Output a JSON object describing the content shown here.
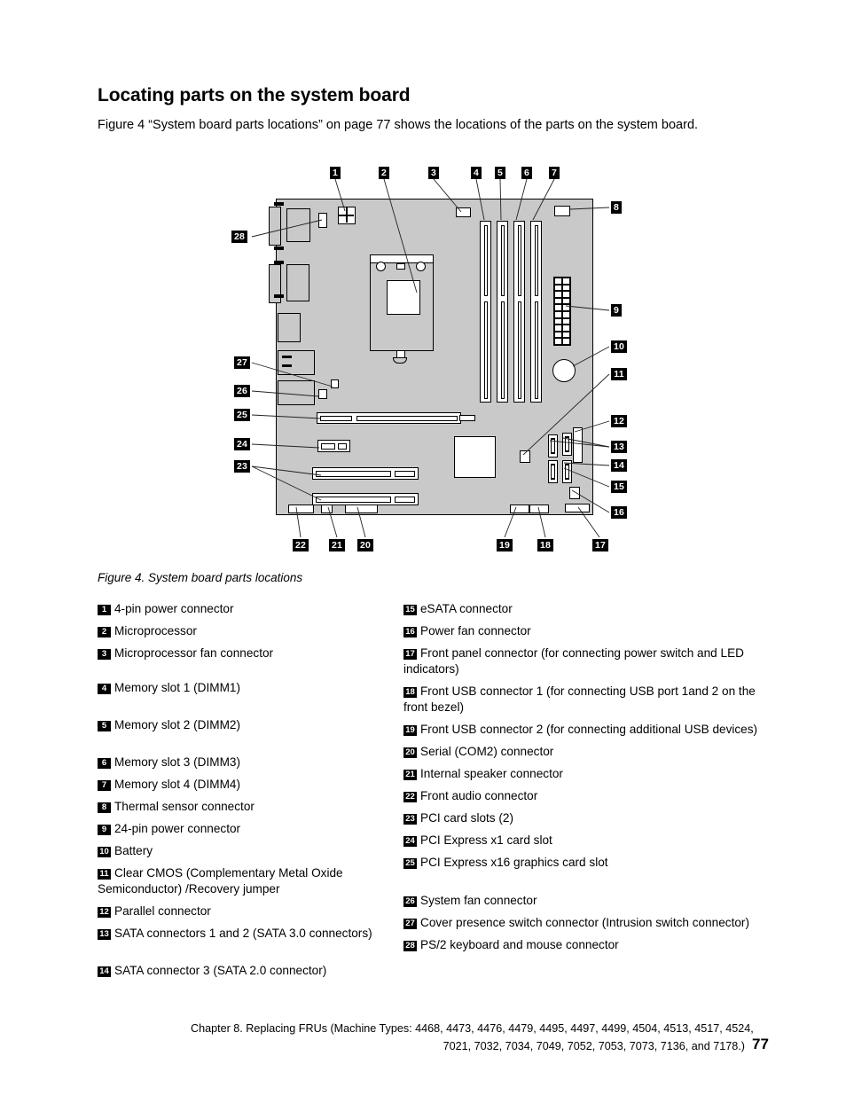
{
  "document": {
    "title": "Locating parts on the system board",
    "intro": "Figure 4 “System board parts locations” on page 77 shows the locations of the parts on the system board.",
    "figure_caption": "Figure 4.  System board parts locations"
  },
  "figure": {
    "callouts": [
      {
        "id": "1",
        "label": "1"
      },
      {
        "id": "2",
        "label": "2"
      },
      {
        "id": "3",
        "label": "3"
      },
      {
        "id": "4",
        "label": "4"
      },
      {
        "id": "5",
        "label": "5"
      },
      {
        "id": "6",
        "label": "6"
      },
      {
        "id": "7",
        "label": "7"
      },
      {
        "id": "8",
        "label": "8"
      },
      {
        "id": "9",
        "label": "9"
      },
      {
        "id": "10",
        "label": "10"
      },
      {
        "id": "11",
        "label": "11"
      },
      {
        "id": "12",
        "label": "12"
      },
      {
        "id": "13",
        "label": "13"
      },
      {
        "id": "14",
        "label": "14"
      },
      {
        "id": "15",
        "label": "15"
      },
      {
        "id": "16",
        "label": "16"
      },
      {
        "id": "17",
        "label": "17"
      },
      {
        "id": "18",
        "label": "18"
      },
      {
        "id": "19",
        "label": "19"
      },
      {
        "id": "20",
        "label": "20"
      },
      {
        "id": "21",
        "label": "21"
      },
      {
        "id": "22",
        "label": "22"
      },
      {
        "id": "23",
        "label": "23"
      },
      {
        "id": "24",
        "label": "24"
      },
      {
        "id": "25",
        "label": "25"
      },
      {
        "id": "26",
        "label": "26"
      },
      {
        "id": "27",
        "label": "27"
      },
      {
        "id": "28",
        "label": "28"
      }
    ],
    "board_color": "#c9c9c9"
  },
  "legend": {
    "left": [
      {
        "num": "1",
        "text": "4-pin power connector"
      },
      {
        "num": "2",
        "text": "Microprocessor"
      },
      {
        "num": "3",
        "text": "Microprocessor fan connector"
      },
      {
        "num": "4",
        "text": "Memory slot 1 (DIMM1)"
      },
      {
        "num": "5",
        "text": "Memory slot 2 (DIMM2)"
      },
      {
        "num": "6",
        "text": "Memory slot 3 (DIMM3)"
      },
      {
        "num": "7",
        "text": "Memory slot 4 (DIMM4)"
      },
      {
        "num": "8",
        "text": "Thermal sensor connector"
      },
      {
        "num": "9",
        "text": "24-pin power connector"
      },
      {
        "num": "10",
        "text": "Battery"
      },
      {
        "num": "11",
        "text": "Clear CMOS (Complementary Metal Oxide Semiconductor) /Recovery jumper"
      },
      {
        "num": "12",
        "text": "Parallel connector"
      },
      {
        "num": "13",
        "text": "SATA connectors 1 and 2 (SATA 3.0 connectors)"
      },
      {
        "num": "14",
        "text": "SATA connector 3 (SATA 2.0 connector)"
      }
    ],
    "right": [
      {
        "num": "15",
        "text": "eSATA connector"
      },
      {
        "num": "16",
        "text": "Power fan connector"
      },
      {
        "num": "17",
        "text": "Front panel connector (for connecting power switch and LED indicators)"
      },
      {
        "num": "18",
        "text": "Front USB connector 1 (for connecting USB port 1and 2 on the front bezel)"
      },
      {
        "num": "19",
        "text": "Front USB connector 2 (for connecting additional USB devices)"
      },
      {
        "num": "20",
        "text": "Serial (COM2) connector"
      },
      {
        "num": "21",
        "text": "Internal speaker connector"
      },
      {
        "num": "22",
        "text": "Front audio connector"
      },
      {
        "num": "23",
        "text": "PCI card slots (2)"
      },
      {
        "num": "24",
        "text": "PCI Express x1 card slot"
      },
      {
        "num": "25",
        "text": "PCI Express x16 graphics card slot"
      },
      {
        "num": "26",
        "text": "System fan connector"
      },
      {
        "num": "27",
        "text": "Cover presence switch connector (Intrusion switch connector)"
      },
      {
        "num": "28",
        "text": "PS/2 keyboard and mouse connector"
      }
    ]
  },
  "footer": {
    "line1": "Chapter 8.  Replacing FRUs (Machine Types:  4468, 4473, 4476, 4479, 4495, 4497, 4499, 4504, 4513, 4517, 4524,",
    "line2": "7021, 7032, 7034, 7049, 7052, 7053, 7073, 7136, and 7178.)",
    "page_number": "77"
  }
}
